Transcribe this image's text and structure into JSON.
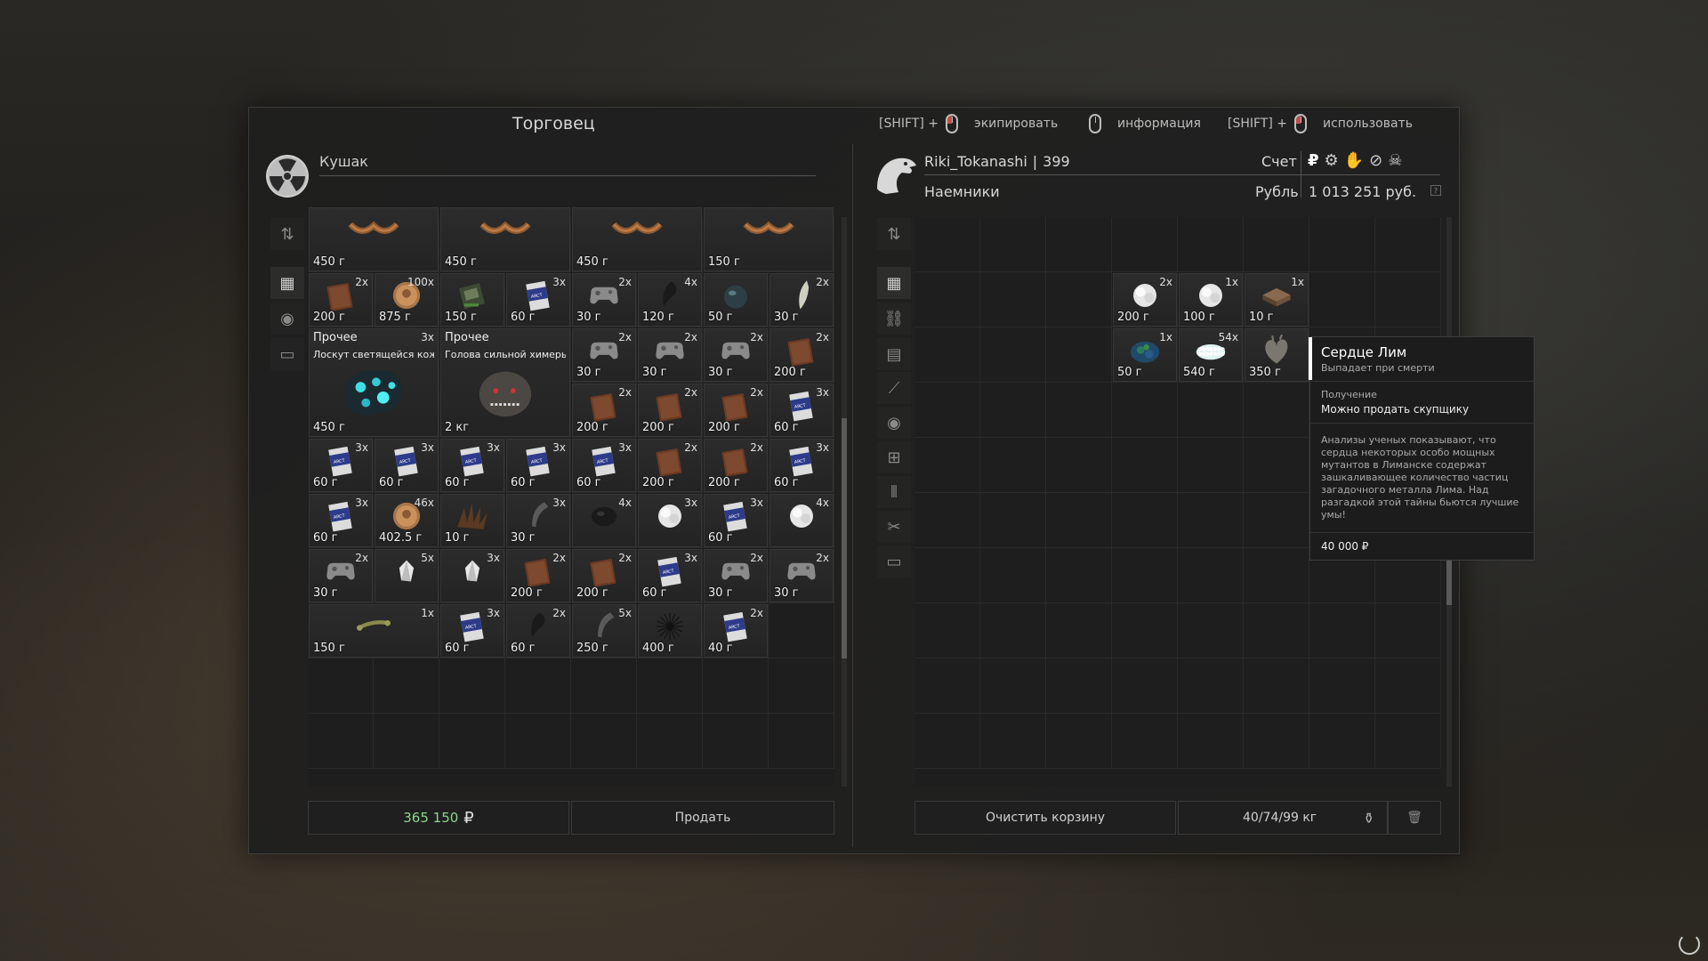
{
  "trader": {
    "panel_title": "Торговец",
    "name": "Кушак"
  },
  "hints": [
    {
      "key": "[SHIFT] +",
      "action": "экипировать"
    },
    {
      "key": "",
      "action": "информация"
    },
    {
      "key": "[SHIFT] +",
      "action": "использовать"
    }
  ],
  "player": {
    "name": "Riki_Tokanashi",
    "separator": "|",
    "level": "399",
    "faction": "Наемники",
    "account_label": "Счет",
    "currency_label": "Рубль",
    "balance": "1 013 251 руб."
  },
  "trader_items": [
    {
      "weight": "450 г",
      "qty": "",
      "label": "",
      "sub": "",
      "art": "chain"
    },
    {
      "weight": "450 г",
      "qty": "",
      "label": "",
      "sub": "",
      "art": "chain"
    },
    {
      "weight": "450 г",
      "qty": "",
      "label": "",
      "sub": "",
      "art": "chain"
    },
    {
      "weight": "150 г",
      "qty": "",
      "label": "",
      "sub": "",
      "art": "chain"
    },
    {
      "weight": "200 г",
      "qty": "2x",
      "art": "book"
    },
    {
      "weight": "875 г",
      "qty": "100x",
      "art": "coin"
    },
    {
      "weight": "150 г",
      "qty": "",
      "art": "device"
    },
    {
      "weight": "60 г",
      "qty": "3x",
      "art": "pack"
    },
    {
      "weight": "30 г",
      "qty": "2x",
      "art": "gamepad"
    },
    {
      "weight": "120 г",
      "qty": "4x",
      "art": "claw"
    },
    {
      "weight": "50 г",
      "qty": "",
      "art": "orb"
    },
    {
      "weight": "30 г",
      "qty": "2x",
      "art": "tooth"
    },
    {
      "weight": "450 г",
      "qty": "3x",
      "label": "Прочее",
      "sub": "Лоскут светящейся кож...",
      "art": "glow"
    },
    {
      "weight": "2 кг",
      "qty": "",
      "label": "Прочее",
      "sub": "Голова сильной химеры",
      "art": "head"
    },
    {
      "weight": "30 г",
      "qty": "2x",
      "art": "gamepad"
    },
    {
      "weight": "30 г",
      "qty": "2x",
      "art": "gamepad"
    },
    {
      "weight": "30 г",
      "qty": "2x",
      "art": "gamepad"
    },
    {
      "weight": "200 г",
      "qty": "2x",
      "art": "book"
    },
    {
      "weight": "200 г",
      "qty": "2x",
      "art": "book"
    },
    {
      "weight": "200 г",
      "qty": "2x",
      "art": "book"
    },
    {
      "weight": "200 г",
      "qty": "2x",
      "art": "book"
    },
    {
      "weight": "60 г",
      "qty": "3x",
      "art": "pack"
    },
    {
      "weight": "60 г",
      "qty": "3x",
      "art": "pack"
    },
    {
      "weight": "60 г",
      "qty": "3x",
      "art": "pack"
    },
    {
      "weight": "60 г",
      "qty": "3x",
      "art": "pack"
    },
    {
      "weight": "60 г",
      "qty": "3x",
      "art": "pack"
    },
    {
      "weight": "60 г",
      "qty": "3x",
      "art": "pack"
    },
    {
      "weight": "200 г",
      "qty": "2x",
      "art": "book"
    },
    {
      "weight": "200 г",
      "qty": "2x",
      "art": "book"
    },
    {
      "weight": "60 г",
      "qty": "3x",
      "art": "pack"
    },
    {
      "weight": "60 г",
      "qty": "3x",
      "art": "pack"
    },
    {
      "weight": "402.5 г",
      "qty": "46x",
      "art": "coin"
    },
    {
      "weight": "10 г",
      "qty": "",
      "art": "spikes"
    },
    {
      "weight": "30 г",
      "qty": "3x",
      "art": "horn"
    },
    {
      "weight": "",
      "qty": "4x",
      "art": "dark"
    },
    {
      "weight": "",
      "qty": "3x",
      "art": "fluff"
    },
    {
      "weight": "60 г",
      "qty": "3x",
      "art": "pack"
    },
    {
      "weight": "",
      "qty": "4x",
      "art": "fluff"
    },
    {
      "weight": "30 г",
      "qty": "2x",
      "art": "gamepad"
    },
    {
      "weight": "",
      "qty": "5x",
      "art": "crystal"
    },
    {
      "weight": "",
      "qty": "3x",
      "art": "crystal"
    },
    {
      "weight": "200 г",
      "qty": "2x",
      "art": "book"
    },
    {
      "weight": "200 г",
      "qty": "2x",
      "art": "book"
    },
    {
      "weight": "60 г",
      "qty": "3x",
      "art": "pack"
    },
    {
      "weight": "30 г",
      "qty": "2x",
      "art": "gamepad"
    },
    {
      "weight": "30 г",
      "qty": "2x",
      "art": "gamepad"
    },
    {
      "weight": "150 г",
      "qty": "1x",
      "art": "bone"
    },
    {
      "weight": "60 г",
      "qty": "3x",
      "art": "pack"
    },
    {
      "weight": "60 г",
      "qty": "2x",
      "art": "claw"
    },
    {
      "weight": "250 г",
      "qty": "5x",
      "art": "horn"
    },
    {
      "weight": "400 г",
      "qty": "",
      "art": "urchin"
    },
    {
      "weight": "40 г",
      "qty": "2x",
      "art": "pack"
    }
  ],
  "cart_items": [
    {
      "weight": "200 г",
      "qty": "2x",
      "art": "fluff"
    },
    {
      "weight": "100 г",
      "qty": "1x",
      "art": "fluff"
    },
    {
      "weight": "10 г",
      "qty": "1x",
      "art": "box"
    },
    {
      "weight": "50 г",
      "qty": "1x",
      "art": "moss"
    },
    {
      "weight": "540 г",
      "qty": "54x",
      "art": "pearls"
    },
    {
      "weight": "350 г",
      "qty": "",
      "art": "heart"
    }
  ],
  "tooltip": {
    "title": "Сердце Лим",
    "subtitle": "Выпадает при смерти",
    "section_label": "Получение",
    "section_value": "Можно продать скупщику",
    "description": "Анализы ученых показывают, что сердца некоторых особо мощных мутантов в Лиманске содержат зашкаливающее количество частиц загадочного металла Лима. Над разгадкой этой тайны бьются лучшие умы!",
    "price": "40 000 ₽"
  },
  "footer": {
    "sell_total": "365 150",
    "currency_symbol": "₽",
    "sell_button": "Продать",
    "clear_button": "Очистить корзину",
    "weight": "40/74/99 кг"
  },
  "colors": {
    "accent_green": "#8fd48f",
    "tooltip_bar": "#ffffff",
    "slot_bg": "#2a2a2a"
  },
  "icons": {
    "trader_avatar": "radiation-icon",
    "player_avatar": "eagle-icon",
    "weight": "kettlebell-icon",
    "trash": "trash-icon",
    "refresh": "refresh-icon"
  }
}
